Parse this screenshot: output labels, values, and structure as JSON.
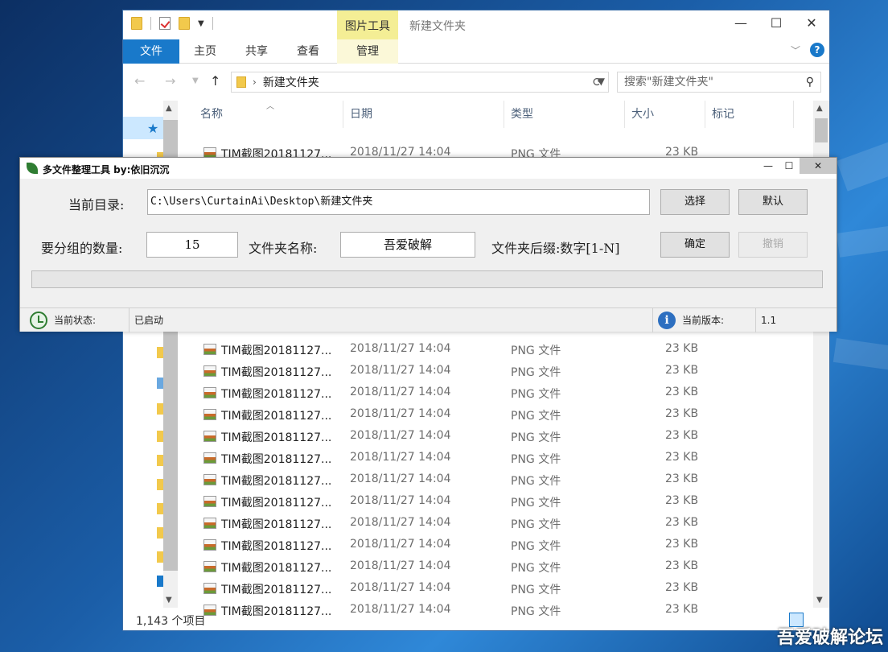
{
  "explorer": {
    "title": "新建文件夹",
    "context_tab": "图片工具",
    "tabs": [
      "文件",
      "主页",
      "共享",
      "查看",
      "管理"
    ],
    "address": "新建文件夹",
    "search_placeholder": "搜索\"新建文件夹\"",
    "columns": [
      "名称",
      "日期",
      "类型",
      "大小",
      "标记"
    ],
    "rows": [
      {
        "name": "TIM截图20181127...",
        "date": "2018/11/27 14:04",
        "type": "PNG 文件",
        "size": "23 KB"
      },
      {
        "name": "TIM截图20181127...",
        "date": "2018/11/27 14:04",
        "type": "PNG 文件",
        "size": "23 KB"
      },
      {
        "name": "TIM截图20181127...",
        "date": "2018/11/27 14:04",
        "type": "PNG 文件",
        "size": "23 KB"
      },
      {
        "name": "TIM截图20181127...",
        "date": "2018/11/27 14:04",
        "type": "PNG 文件",
        "size": "23 KB"
      },
      {
        "name": "TIM截图20181127...",
        "date": "2018/11/27 14:04",
        "type": "PNG 文件",
        "size": "23 KB"
      },
      {
        "name": "TIM截图20181127...",
        "date": "2018/11/27 14:04",
        "type": "PNG 文件",
        "size": "23 KB"
      },
      {
        "name": "TIM截图20181127...",
        "date": "2018/11/27 14:04",
        "type": "PNG 文件",
        "size": "23 KB"
      },
      {
        "name": "TIM截图20181127...",
        "date": "2018/11/27 14:04",
        "type": "PNG 文件",
        "size": "23 KB"
      },
      {
        "name": "TIM截图20181127...",
        "date": "2018/11/27 14:04",
        "type": "PNG 文件",
        "size": "23 KB"
      },
      {
        "name": "TIM截图20181127...",
        "date": "2018/11/27 14:04",
        "type": "PNG 文件",
        "size": "23 KB"
      },
      {
        "name": "TIM截图20181127...",
        "date": "2018/11/27 14:04",
        "type": "PNG 文件",
        "size": "23 KB"
      },
      {
        "name": "TIM截图20181127...",
        "date": "2018/11/27 14:04",
        "type": "PNG 文件",
        "size": "23 KB"
      },
      {
        "name": "TIM截图20181127...",
        "date": "2018/11/27 14:04",
        "type": "PNG 文件",
        "size": "23 KB"
      },
      {
        "name": "TIM截图20181127...",
        "date": "2018/11/27 14:04",
        "type": "PNG 文件",
        "size": "23 KB"
      }
    ],
    "status_count": "1,143 个项目",
    "colors": {
      "file_tab": "#1979ca",
      "context_tab": "#f4ee95"
    }
  },
  "tool": {
    "title": "多文件整理工具 by:依旧沉沉",
    "dir_label": "当前目录:",
    "dir_value": "C:\\Users\\CurtainAi\\Desktop\\新建文件夹",
    "select_button": "选择",
    "default_button": "默认",
    "group_label": "要分组的数量:",
    "group_value": "15",
    "folder_name_label": "文件夹名称:",
    "folder_name_value": "吾爱破解",
    "suffix_label": "文件夹后缀:数字[1-N]",
    "confirm_button": "确定",
    "undo_button": "撤销",
    "progress": 0,
    "status_label": "当前状态:",
    "status_value": "已启动",
    "version_label": "当前版本:",
    "version_value": "1.1",
    "icons": [
      "leaf-icon",
      "clock-icon",
      "info-icon"
    ]
  },
  "watermark": "吾爱破解论坛"
}
